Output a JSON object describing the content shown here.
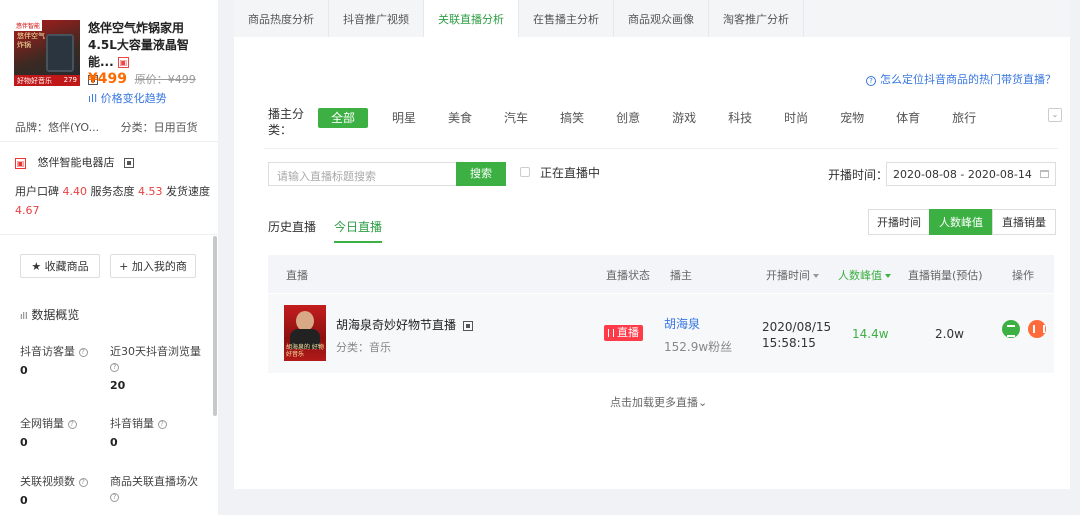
{
  "product": {
    "image_tag": "悠伴智能",
    "image_text": "悠伴空气炸锅",
    "image_price": "279",
    "image_caption": "好物好音乐",
    "title": "悠伴空气炸锅家用4.5L大容量液晶智能...",
    "price": "¥499",
    "original_price": "原价：¥499",
    "price_trend": "价格变化趋势",
    "brand": "品牌：悠伴(YO...",
    "category": "分类：日用百货"
  },
  "shop": {
    "name": "悠伴智能电器店",
    "icon": "shop-icon",
    "scores_prefix": "用户口碑",
    "reputation": "4.40",
    "service_label": "服务态度",
    "service": "4.53",
    "delivery_label": "发货速度",
    "delivery": "4.67"
  },
  "actions": {
    "favorite": "★ 收藏商品",
    "add": "+  加入我的商"
  },
  "overview": {
    "title": "数据概览",
    "stats": [
      {
        "label": "抖音访客量",
        "value": "0"
      },
      {
        "label": "近30天抖音浏览量",
        "value": "20"
      },
      {
        "label": "全网销量",
        "value": "0"
      },
      {
        "label": "抖音销量",
        "value": "0"
      },
      {
        "label": "关联视频数",
        "value": "0"
      },
      {
        "label": "商品关联直播场次",
        "value": ""
      }
    ]
  },
  "tabs": [
    "商品热度分析",
    "抖音推广视频",
    "关联直播分析",
    "在售播主分析",
    "商品观众画像",
    "淘客推广分析"
  ],
  "active_tab": "关联直播分析",
  "help_link": "怎么定位抖音商品的热门带货直播？",
  "anchor_category": {
    "label": "播主分类：",
    "options": [
      "全部",
      "明星",
      "美食",
      "汽车",
      "搞笑",
      "创意",
      "游戏",
      "科技",
      "时尚",
      "宠物",
      "体育",
      "旅行"
    ],
    "selected": "全部"
  },
  "search": {
    "placeholder": "请输入直播标题搜索",
    "button": "搜索"
  },
  "live_now": "正在直播中",
  "date": {
    "label": "开播时间：",
    "range": "2020-08-08 - 2020-08-14"
  },
  "sub_tabs": [
    "历史直播",
    "今日直播"
  ],
  "active_sub_tab": "今日直播",
  "sort_buttons": [
    "开播时间",
    "人数峰值",
    "直播销量"
  ],
  "active_sort": "人数峰值",
  "table": {
    "headers": [
      "直播",
      "直播状态",
      "播主",
      "开播时间",
      "人数峰值",
      "直播销量(预估)",
      "操作"
    ],
    "rows": [
      {
        "title": "胡海泉奇妙好物节直播",
        "category": "分类：音乐",
        "thumb_caption": "胡海泉的 好物好音乐",
        "status": "直播",
        "anchor": "胡海泉",
        "fans": "152.9w粉丝",
        "start_date": "2020/08/15",
        "start_time": "15:58:15",
        "peak": "14.4w",
        "sales": "2.0w"
      }
    ]
  },
  "load_more": "点击加载更多直播⌄",
  "colors": {
    "accent": "#3cb043",
    "price": "#ff6a00",
    "live": "#ff3b4a",
    "link": "#3877e0"
  }
}
